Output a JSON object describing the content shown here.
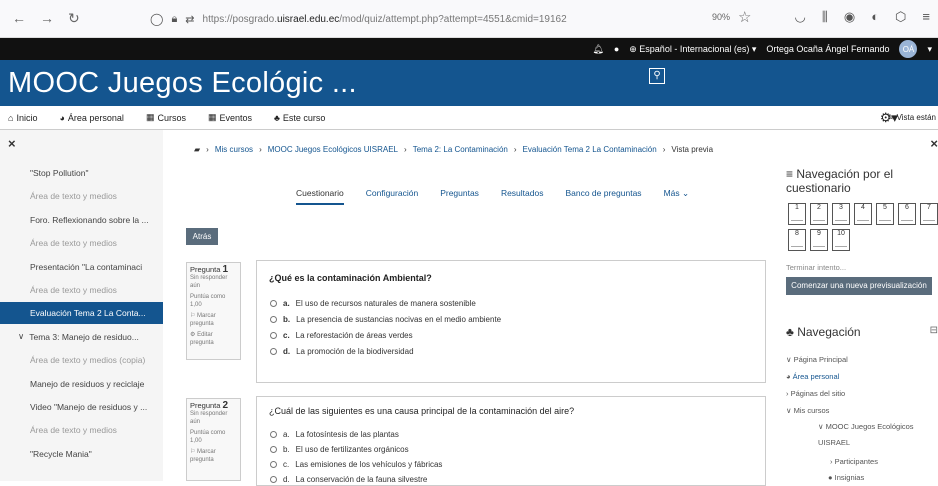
{
  "browser": {
    "url_pre": "https://posgrado.",
    "url_host": "uisrael.edu.ec",
    "url_post": "/mod/quiz/attempt.php?attempt=4551&cmid=19162",
    "zoom": "90%"
  },
  "topbar": {
    "language": "Español - Internacional (es)",
    "user_name": "Ortega Ocaña Ángel Fernando",
    "user_initials": "OÁ"
  },
  "banner": {
    "title": "MOOC Juegos Ecológic ..."
  },
  "menu": {
    "inicio": "Inicio",
    "area": "Área personal",
    "cursos": "Cursos",
    "eventos": "Eventos",
    "curso": "Este curso",
    "vista": "Vista están"
  },
  "left_drawer": {
    "items": [
      "\"Stop Pollution\"",
      "Área de texto y medios",
      "Foro. Reflexionando sobre la ...",
      "Área de texto y medios",
      "Presentación \"La contaminaci",
      "Área de texto y medios",
      "Evaluación Tema 2 La Conta...",
      "Tema 3: Manejo de residuo...",
      "Área de texto y medios (copia)",
      "Manejo de residuos y reciclaje",
      "Video \"Manejo de residuos y ...",
      "Área de texto y medios",
      "\"Recycle Mania\""
    ]
  },
  "breadcrumb": [
    "Mis cursos",
    "MOOC Juegos Ecológicos UISRAEL",
    "Tema 2: La Contaminación",
    "Evaluación Tema 2 La Contaminación",
    "Vista previa"
  ],
  "tabs": [
    "Cuestionario",
    "Configuración",
    "Preguntas",
    "Resultados",
    "Banco de preguntas",
    "Más"
  ],
  "back_button": "Atrás",
  "questions": [
    {
      "label": "Pregunta",
      "number": "1",
      "status": "Sin responder aún",
      "score": "Puntúa como 1,00",
      "flag": "Marcar pregunta",
      "edit": "Editar pregunta",
      "text": "¿Qué es la contaminación Ambiental?",
      "options": [
        {
          "letter": "a.",
          "text": "El uso de recursos naturales de manera sostenible"
        },
        {
          "letter": "b.",
          "text": "La presencia de sustancias nocivas en el medio ambiente"
        },
        {
          "letter": "c.",
          "text": "La reforestación de áreas verdes"
        },
        {
          "letter": "d.",
          "text": "La promoción de la biodiversidad"
        }
      ]
    },
    {
      "label": "Pregunta",
      "number": "2",
      "status": "Sin responder aún",
      "score": "Puntúa como 1,00",
      "flag": "Marcar pregunta",
      "text": "¿Cuál de las siguientes es una causa principal de la contaminación del aire?",
      "options": [
        {
          "letter": "a.",
          "text": "La fotosíntesis de las plantas"
        },
        {
          "letter": "b.",
          "text": "El uso de fertilizantes orgánicos"
        },
        {
          "letter": "c.",
          "text": "Las emisiones de los vehículos y fábricas"
        },
        {
          "letter": "d.",
          "text": "La conservación de la fauna silvestre"
        }
      ]
    }
  ],
  "quiz_nav": {
    "title": "Navegación por el cuestionario",
    "cells": [
      "1",
      "2",
      "3",
      "4",
      "5",
      "6",
      "7",
      "8",
      "9",
      "10"
    ],
    "finish": "Terminar intento...",
    "new_preview": "Comenzar una nueva previsualización"
  },
  "navigation": {
    "title": "Navegación",
    "items": [
      "Página Principal",
      "Área personal",
      "Páginas del sitio",
      "Mis cursos",
      "MOOC Juegos Ecológicos",
      "UISRAEL",
      "Participantes",
      "Insignias"
    ]
  }
}
